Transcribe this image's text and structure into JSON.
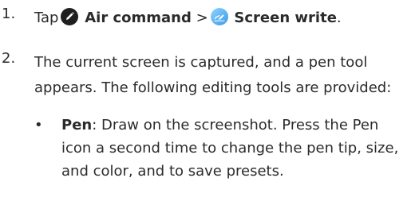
{
  "steps": [
    {
      "number": "1.",
      "tap_word": "Tap",
      "air_command": "Air command",
      "separator": ">",
      "screen_write": "Screen write",
      "end": "."
    },
    {
      "number": "2.",
      "text": "The current screen is captured, and a pen tool appears. The following editing tools are provided:",
      "bullets": [
        {
          "marker": "•",
          "term": "Pen",
          "description": ": Draw on the screenshot. Press the Pen icon a second time to change the pen tip, size, and color, and to save presets."
        }
      ]
    }
  ],
  "icons": {
    "air_command": "air-command-icon",
    "screen_write": "screen-write-icon"
  },
  "colors": {
    "text": "#2b2b2b",
    "air_command_icon": "#1f1f1f",
    "screen_write_icon": "#5fb4f0"
  }
}
